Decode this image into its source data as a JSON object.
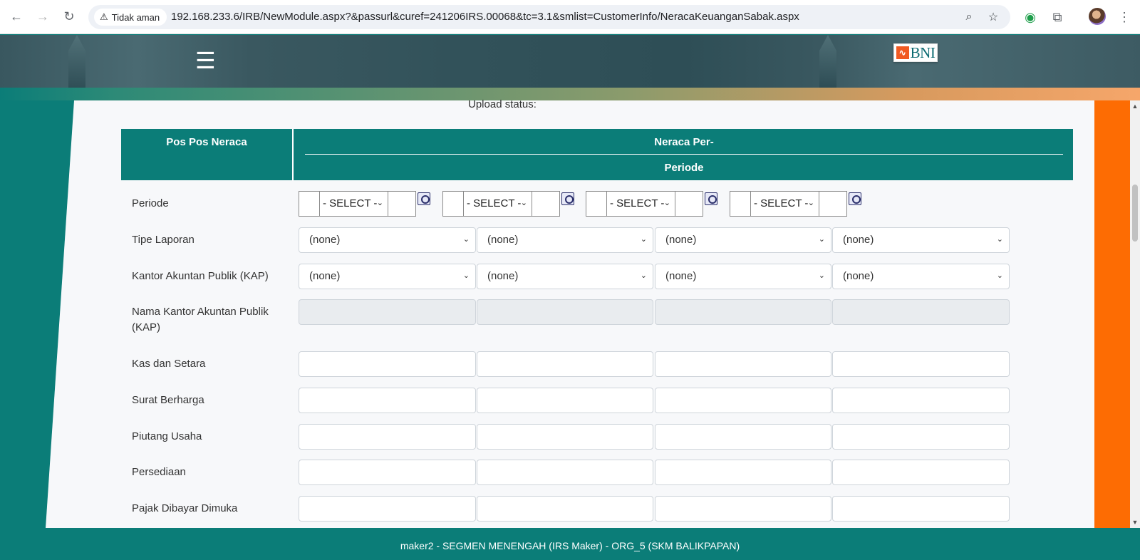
{
  "browser": {
    "security_label": "Tidak aman",
    "url": "192.168.233.6/IRB/NewModule.aspx?&passurl&curef=241206IRS.00068&tc=3.1&smlist=CustomerInfo/NeracaKeuanganSabak.aspx"
  },
  "header": {
    "menu_glyph": "☰",
    "logo_text": "BNI"
  },
  "content": {
    "upload_status": "Upload status:"
  },
  "table": {
    "col_left": "Pos Pos Neraca",
    "col_right_top": "Neraca Per-",
    "col_right_bottom": "Periode"
  },
  "rows": {
    "periode": "Periode",
    "tipe_laporan": "Tipe Laporan",
    "kap": "Kantor Akuntan Publik (KAP)",
    "nama_kap": "Nama Kantor Akuntan Publik (KAP)",
    "kas": "Kas dan Setara",
    "surat": "Surat Berharga",
    "piutang": "Piutang Usaha",
    "persediaan": "Persediaan",
    "pajak": "Pajak Dibayar Dimuka"
  },
  "periode_select": {
    "label": "- SELECT -"
  },
  "dropdowns": {
    "none": "(none)"
  },
  "footer": {
    "text": "maker2 - SEGMEN MENENGAH (IRS Maker) - ORG_5 (SKM BALIKPAPAN)"
  },
  "colors": {
    "teal": "#0b7d78",
    "orange": "#fd6c03",
    "bni_orange": "#f15a22"
  }
}
